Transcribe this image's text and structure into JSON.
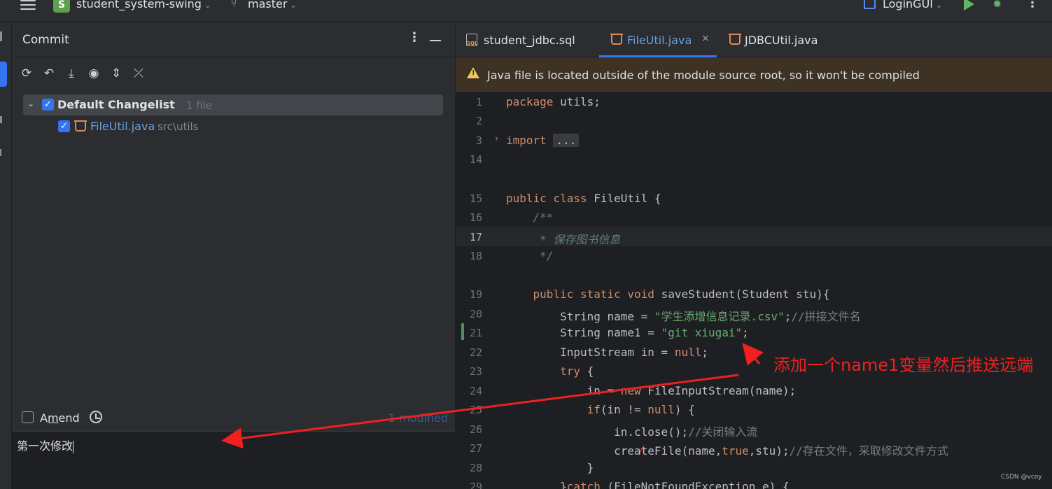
{
  "topbar": {
    "project_badge": "S",
    "project_name": "student_system-swing",
    "branch_name": "master",
    "run_config": "LoginGUI",
    "icons": [
      "hamburger-icon",
      "branch-icon",
      "run-config-icon",
      "run-icon",
      "debug-icon",
      "more-icon"
    ]
  },
  "commit_panel": {
    "title": "Commit",
    "changelist": {
      "name": "Default Changelist",
      "count": "1 file",
      "checked": true
    },
    "files": [
      {
        "name": "FileUtil.java",
        "path": "src\\utils",
        "checked": true
      }
    ],
    "amend_label_pre": "A",
    "amend_label_u": "m",
    "amend_label_post": "end",
    "modified": "1 modified",
    "message": "第一次修改"
  },
  "tabs": [
    {
      "label": "student_jdbc.sql",
      "active": false
    },
    {
      "label": "FileUtil.java",
      "active": true,
      "close": "×"
    },
    {
      "label": "JDBCUtil.java",
      "active": false
    }
  ],
  "banner": {
    "text": "Java file is located outside of the module source root, so it won't be compiled"
  },
  "editor": {
    "current_line": "17",
    "lines": [
      {
        "n": "1",
        "code": "package utils;"
      },
      {
        "n": "2",
        "code": ""
      },
      {
        "n": "3",
        "code": "import ..."
      },
      {
        "n": "14",
        "code": ""
      },
      {
        "n": "15",
        "code": "public class FileUtil {"
      },
      {
        "n": "16",
        "code": "    /**"
      },
      {
        "n": "17",
        "code": "     * 保存图书信息"
      },
      {
        "n": "18",
        "code": "     */"
      },
      {
        "n": "19",
        "code": "    public static void saveStudent(Student stu){"
      },
      {
        "n": "20",
        "code": "        String name = \"学生添增信息记录.csv\";//拼接文件名"
      },
      {
        "n": "21",
        "code": "        String name1 = \"git xiugai\";"
      },
      {
        "n": "22",
        "code": "        InputStream in = null;"
      },
      {
        "n": "23",
        "code": "        try {"
      },
      {
        "n": "24",
        "code": "            in = new FileInputStream(name);"
      },
      {
        "n": "25",
        "code": "            if(in != null) {"
      },
      {
        "n": "26",
        "code": "                in.close();//关闭输入流"
      },
      {
        "n": "27",
        "code": "                createFile(name,true,stu);//存在文件，采取修改文件方式"
      },
      {
        "n": "28",
        "code": "            }"
      },
      {
        "n": "29",
        "code": "        }catch (FileNotFoundException e) {"
      }
    ]
  },
  "annotation": {
    "text": "添加一个name1变量然后推送远端",
    "color": "#f02020"
  },
  "watermark": "CSDN @vcoy",
  "colors": {
    "accent": "#3574f0",
    "keyword": "#cf8e6d",
    "string": "#6aab73",
    "comment": "#7a7e85",
    "annotation": "#f02020"
  }
}
